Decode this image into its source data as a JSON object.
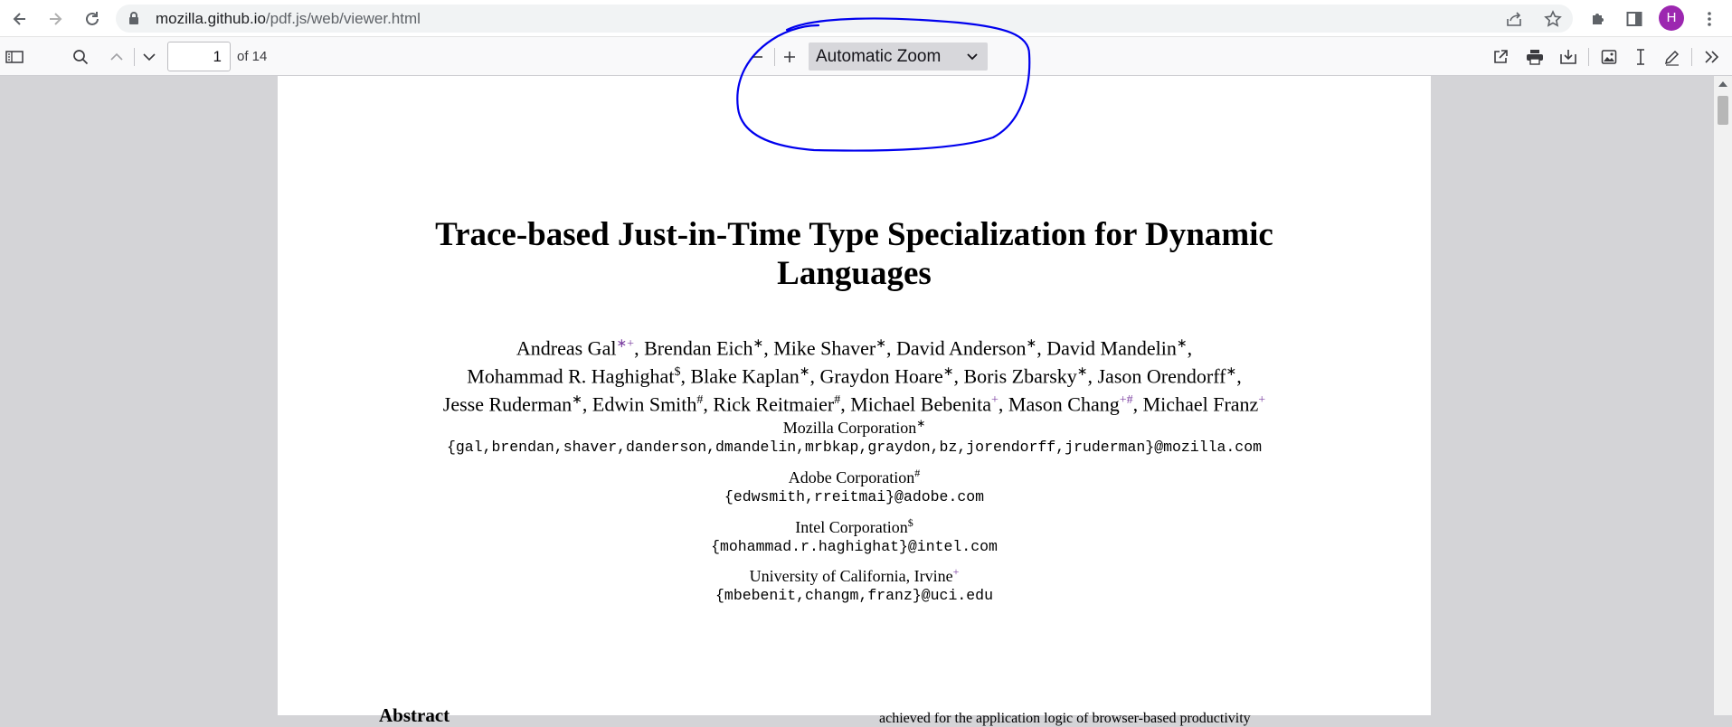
{
  "browser": {
    "url_host": "mozilla.github.io",
    "url_path": "/pdf.js/web/viewer.html",
    "avatar_letter": "H"
  },
  "pdf_toolbar": {
    "page_number": "1",
    "page_count": "of 14",
    "zoom": "Automatic Zoom"
  },
  "paper": {
    "title_line1": "Trace-based Just-in-Time Type Specialization for Dynamic",
    "title_line2": "Languages",
    "authors": [
      [
        {
          "name": "Andreas Gal",
          "mark": "∗+"
        },
        {
          "name": ", Brendan Eich",
          "mark": "∗"
        },
        {
          "name": ", Mike Shaver",
          "mark": "∗"
        },
        {
          "name": ", David Anderson",
          "mark": "∗"
        },
        {
          "name": ", David Mandelin",
          "mark": "∗"
        },
        {
          "name": ",",
          "mark": ""
        }
      ],
      [
        {
          "name": "Mohammad R. Haghighat",
          "mark": "$"
        },
        {
          "name": ", Blake Kaplan",
          "mark": "∗"
        },
        {
          "name": ", Graydon Hoare",
          "mark": "∗"
        },
        {
          "name": ", Boris Zbarsky",
          "mark": "∗"
        },
        {
          "name": ", Jason Orendorff",
          "mark": "∗"
        },
        {
          "name": ",",
          "mark": ""
        }
      ],
      [
        {
          "name": "Jesse Ruderman",
          "mark": "∗"
        },
        {
          "name": ", Edwin Smith",
          "mark": "#"
        },
        {
          "name": ", Rick Reitmaier",
          "mark": "#"
        },
        {
          "name": ", Michael Bebenita",
          "mark": "+"
        },
        {
          "name": ", Mason Chang",
          "mark": "+#"
        },
        {
          "name": ", Michael Franz",
          "mark": "+"
        }
      ]
    ],
    "affiliations": [
      {
        "org": "Mozilla Corporation",
        "mark": "∗",
        "emails": "{gal,brendan,shaver,danderson,dmandelin,mrbkap,graydon,bz,jorendorff,jruderman}@mozilla.com"
      },
      {
        "org": "Adobe Corporation",
        "mark": "#",
        "emails": "{edwsmith,rreitmai}@adobe.com"
      },
      {
        "org": "Intel Corporation",
        "mark": "$",
        "emails": "{mohammad.r.haghighat}@intel.com"
      },
      {
        "org": "University of California, Irvine",
        "mark": "+",
        "emails": "{mbebenit,changm,franz}@uci.edu"
      }
    ],
    "abstract_heading": "Abstract",
    "column_cut_text": "achieved for the application logic of browser-based productivity"
  },
  "icons": {
    "back": "back-arrow-icon",
    "forward": "forward-arrow-icon",
    "reload": "reload-icon",
    "lock": "lock-icon",
    "share": "share-icon",
    "star": "star-icon",
    "extensions": "puzzle-icon",
    "side_panel": "side-panel-icon",
    "menu": "kebab-menu-icon"
  },
  "colors": {
    "annotation_ink": "#0000ee",
    "avatar": "#9c27b0",
    "superscript_plus": "#7b3fa0"
  }
}
